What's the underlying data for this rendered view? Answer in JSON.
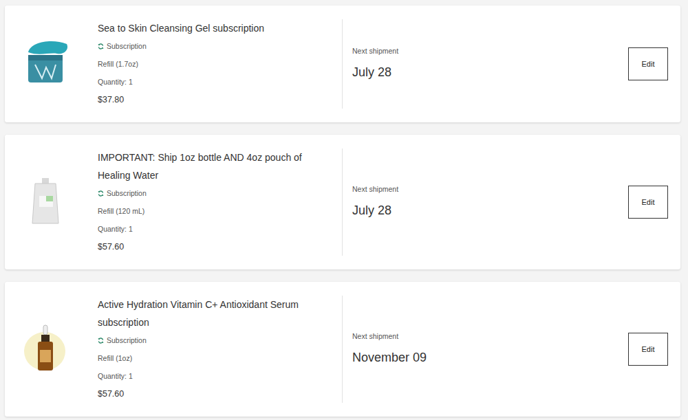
{
  "subscriptions": [
    {
      "kind": "jar",
      "title": "Sea to Skin Cleansing Gel subscription",
      "badge": "Subscription",
      "variant": "Refill (1.7oz)",
      "quantity": "Quantity: 1",
      "price": "$37.80",
      "next_label": "Next shipment",
      "next_date": "July 28",
      "button": "Edit"
    },
    {
      "kind": "pouch",
      "title": "IMPORTANT: Ship 1oz bottle AND 4oz pouch of Healing Water",
      "badge": "Subscription",
      "variant": "Refill (120 mL)",
      "quantity": "Quantity: 1",
      "price": "$57.60",
      "next_label": "Next shipment",
      "next_date": "July 28",
      "button": "Edit"
    },
    {
      "kind": "dropper",
      "title": "Active Hydration Vitamin C+ Antioxidant Serum subscription",
      "badge": "Subscription",
      "variant": "Refill (1oz)",
      "quantity": "Quantity: 1",
      "price": "$57.60",
      "next_label": "Next shipment",
      "next_date": "November 09",
      "button": "Edit"
    }
  ]
}
